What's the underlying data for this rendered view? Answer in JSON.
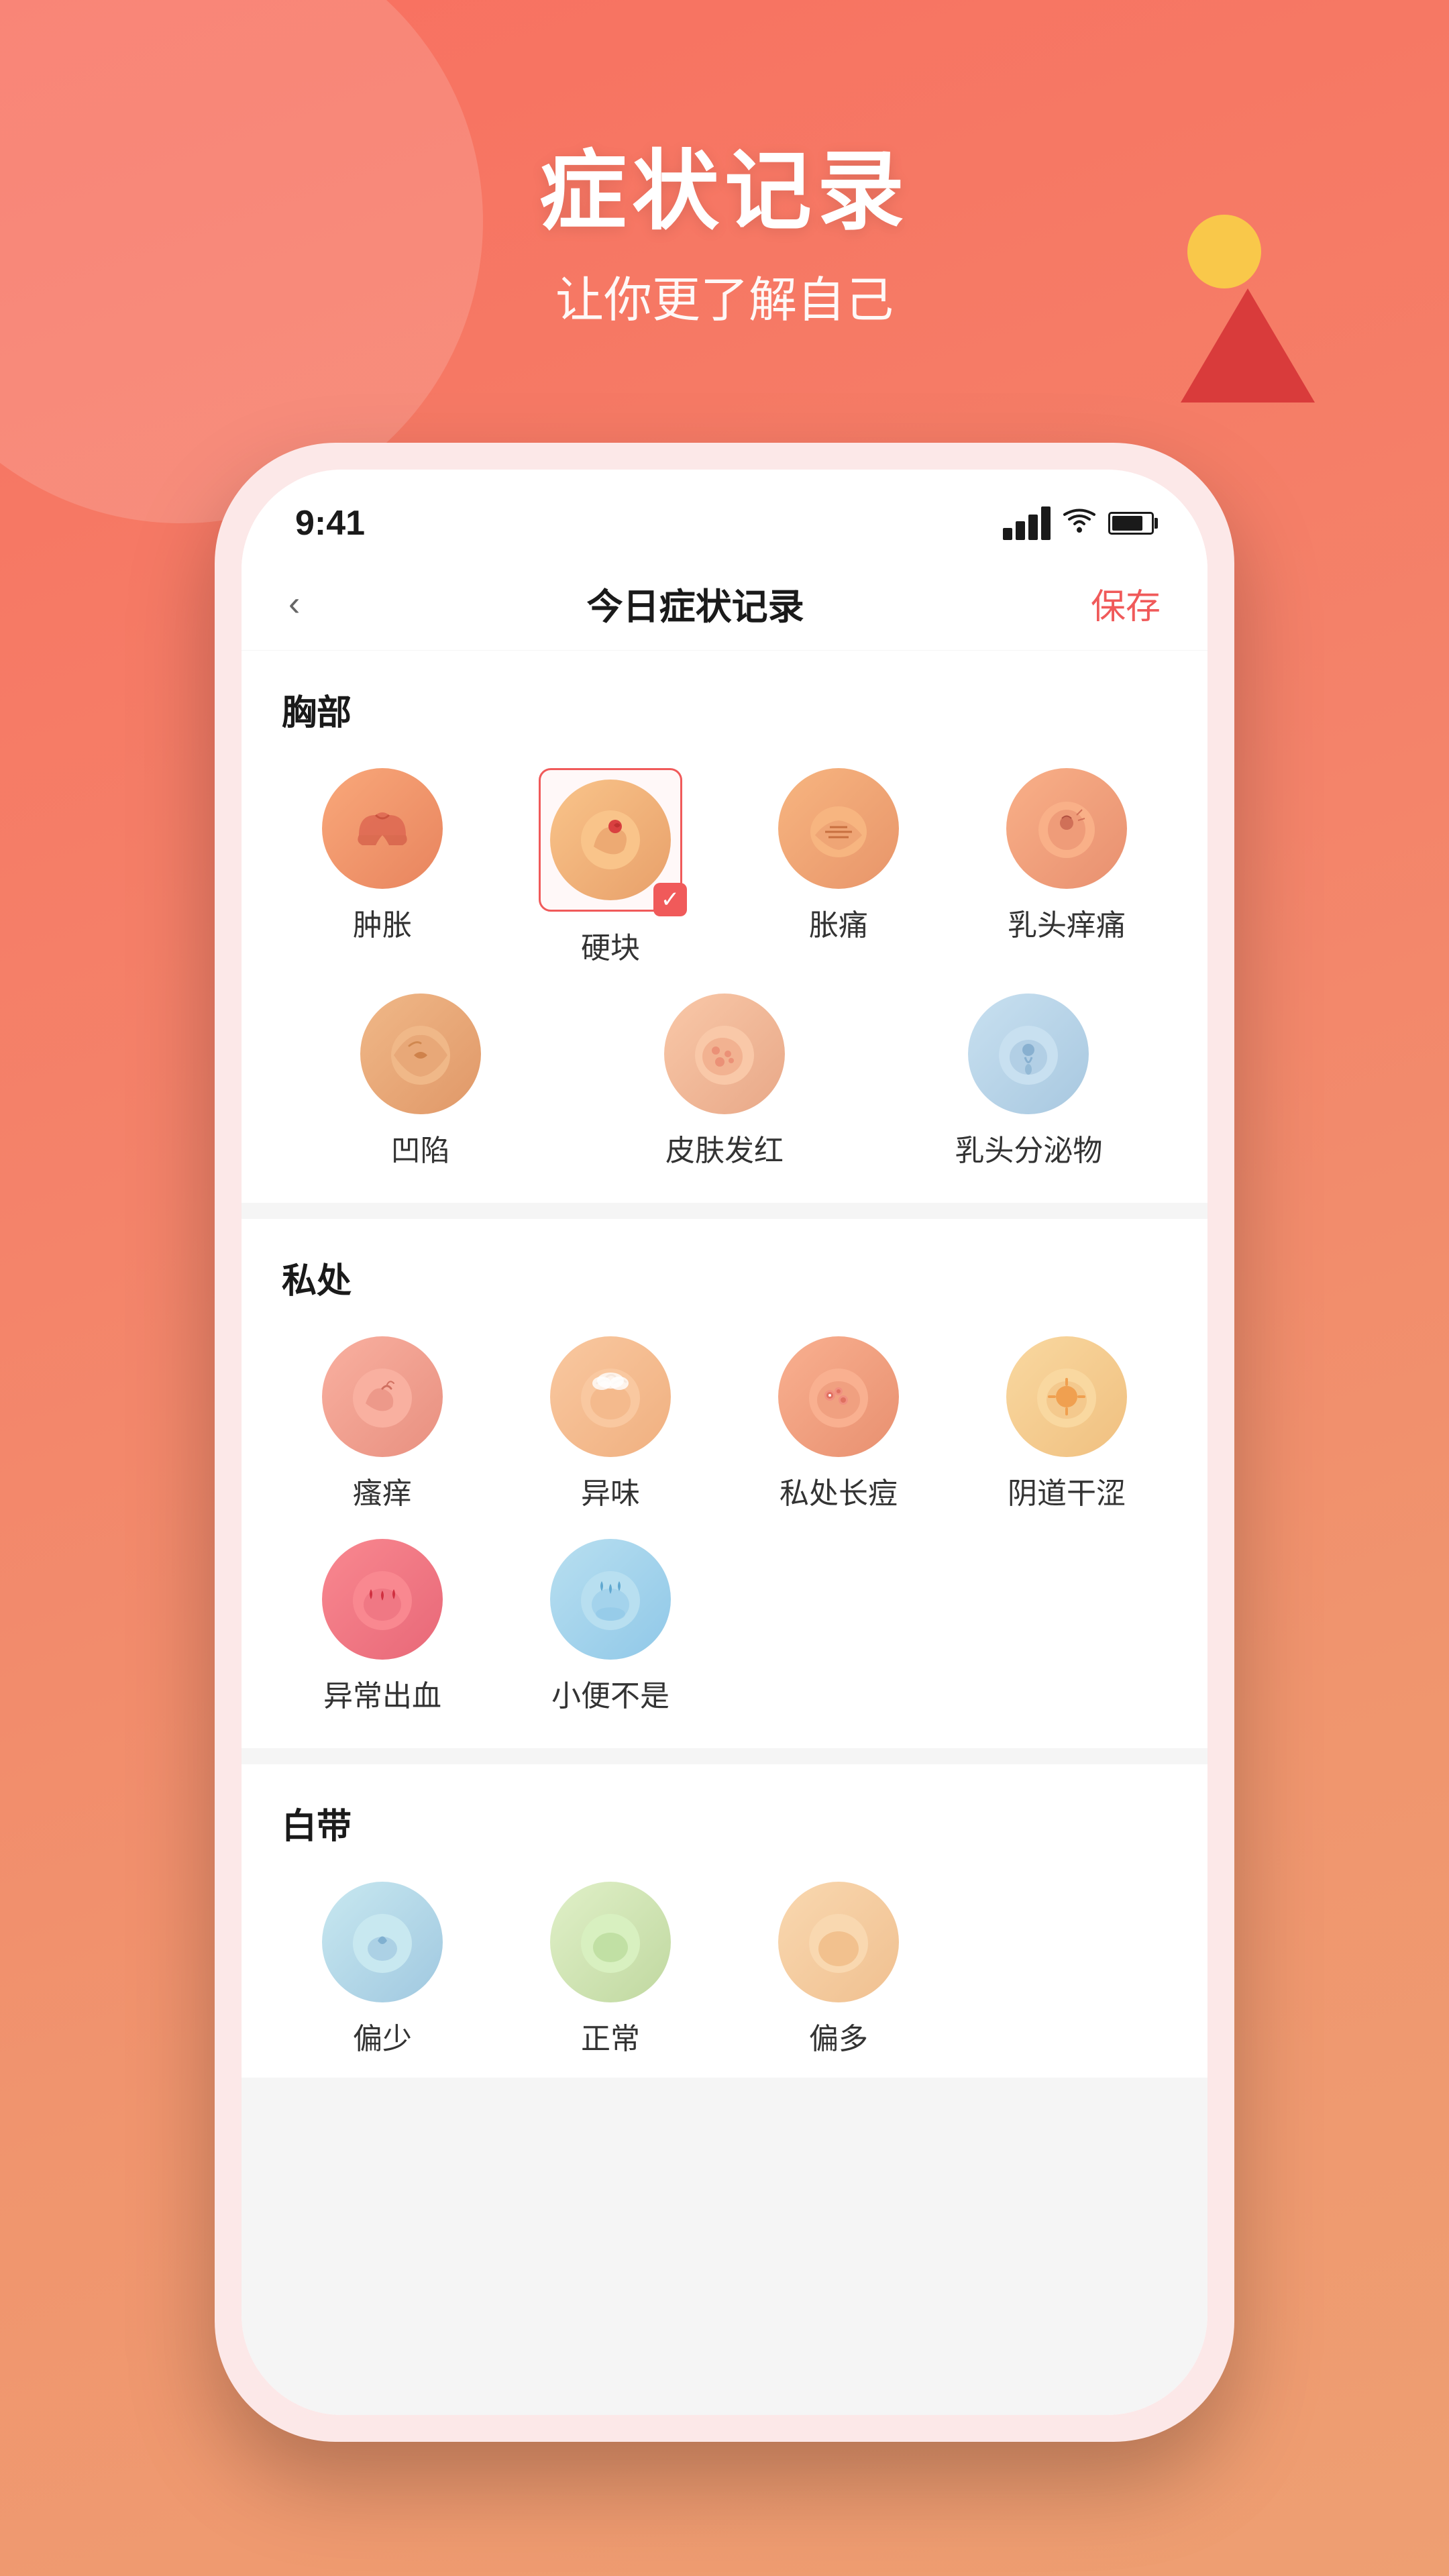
{
  "background": {
    "gradient_start": "#f87060",
    "gradient_end": "#ee9f72"
  },
  "header": {
    "title": "症状记录",
    "subtitle": "让你更了解自己"
  },
  "status_bar": {
    "time": "9:41",
    "signal_label": "signal",
    "wifi_label": "wifi",
    "battery_label": "battery"
  },
  "nav": {
    "back_icon": "chevron-left",
    "title": "今日症状记录",
    "save_label": "保存"
  },
  "sections": [
    {
      "id": "chest",
      "title": "胸部",
      "items": [
        {
          "id": "zhongzhang",
          "label": "肿胀",
          "selected": false
        },
        {
          "id": "yingkuai",
          "label": "硬块",
          "selected": true
        },
        {
          "id": "zhangtong",
          "label": "胀痛",
          "selected": false
        },
        {
          "id": "rutouchengtong",
          "label": "乳头痒痛",
          "selected": false
        },
        {
          "id": "aoxian",
          "label": "凹陷",
          "selected": false
        },
        {
          "id": "pifufahong",
          "label": "皮肤发红",
          "selected": false
        },
        {
          "id": "rutoufen",
          "label": "乳头分泌物",
          "selected": false
        }
      ]
    },
    {
      "id": "private",
      "title": "私处",
      "items": [
        {
          "id": "yangyang",
          "label": "瘙痒",
          "selected": false
        },
        {
          "id": "yiwei",
          "label": "异味",
          "selected": false
        },
        {
          "id": "sizuchanzhen",
          "label": "私处长痘",
          "selected": false
        },
        {
          "id": "yindaogannie",
          "label": "阴道干涩",
          "selected": false
        },
        {
          "id": "yichangchuxue",
          "label": "异常出血",
          "selected": false
        },
        {
          "id": "xiaobian",
          "label": "小便不是",
          "selected": false
        }
      ]
    },
    {
      "id": "discharge",
      "title": "白带",
      "items": [
        {
          "id": "baidi1",
          "label": "偏少",
          "selected": false
        },
        {
          "id": "baidi2",
          "label": "正常",
          "selected": false
        },
        {
          "id": "baidi3",
          "label": "偏多",
          "selected": false
        }
      ]
    }
  ]
}
